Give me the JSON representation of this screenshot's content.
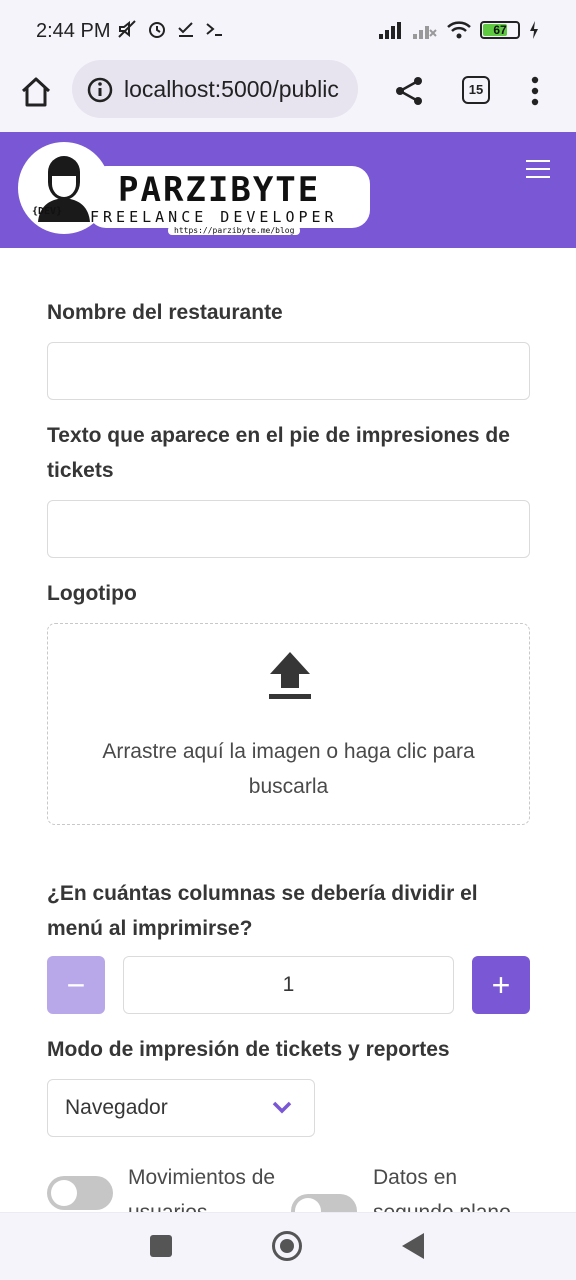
{
  "status_bar": {
    "time": "2:44 PM",
    "battery": "67",
    "icons": [
      "mute-icon",
      "alarm-icon",
      "check-icon",
      "terminal-icon",
      "signal-icon",
      "signal-off-icon",
      "wifi-icon",
      "battery-icon",
      "charging-icon"
    ]
  },
  "browser": {
    "url": "localhost:5000/public",
    "tab_count": "15"
  },
  "navbar": {
    "logo_title": "PARZIBYTE",
    "logo_subtitle": "FREELANCE DEVELOPER",
    "logo_url": "https://parzibyte.me/blog",
    "logo_badge": "{DEV}",
    "brand_color": "#7957d5"
  },
  "form": {
    "restaurant_label": "Nombre del restaurante",
    "restaurant_value": "",
    "footer_label": "Texto que aparece en el pie de impresiones de tickets",
    "footer_value": "",
    "logo_label": "Logotipo",
    "dropzone_text": "Arrastre aquí la imagen o haga clic para buscarla",
    "columns_label": "¿En cuántas columnas se debería dividir el menú al imprimirse?",
    "columns_value": "1",
    "minus_label": "−",
    "plus_label": "+",
    "print_mode_label": "Modo de impresión de tickets y reportes",
    "print_mode_value": "Navegador",
    "switch_1_label": "Movimientos de usuarios",
    "switch_2_label": "Datos en segundo plano"
  }
}
